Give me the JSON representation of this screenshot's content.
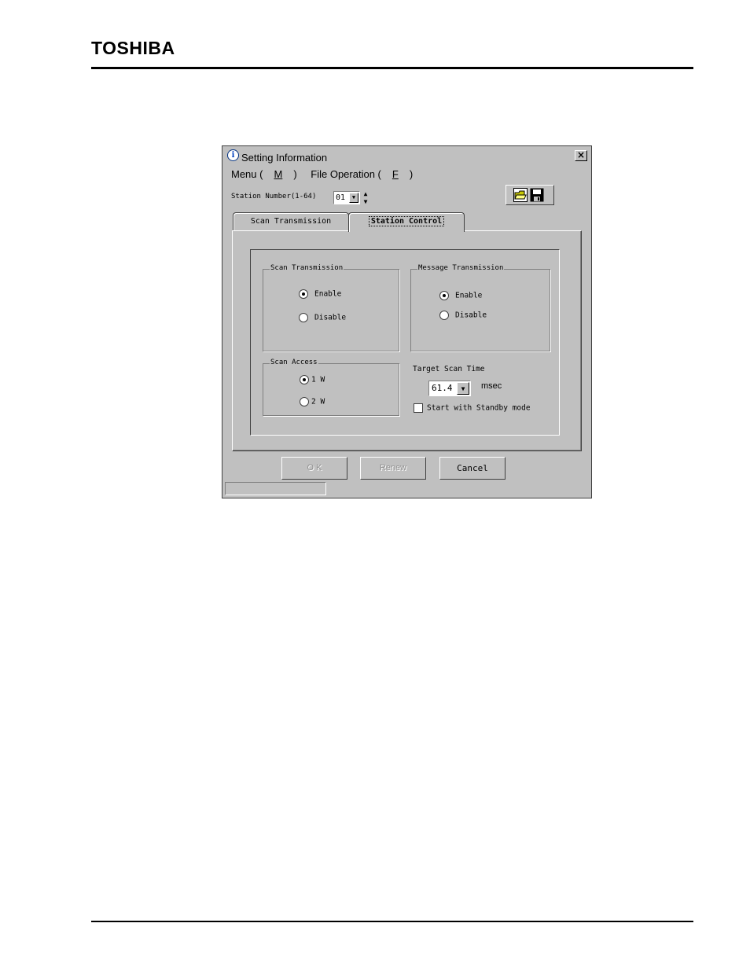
{
  "header": {
    "logo": "TOSHIBA"
  },
  "window": {
    "title": "Setting Information",
    "close_label": "×",
    "menu": {
      "menu_label": "Menu (",
      "menu_key": "M",
      "menu_end": ")",
      "file_label": "File Operation (",
      "file_key": "F",
      "file_end": ")"
    },
    "station": {
      "label": "Station Number(1-64)",
      "value": "01"
    },
    "tabs": [
      {
        "label": "Scan Transmission",
        "active": false
      },
      {
        "label": "Station Control",
        "active": true
      }
    ],
    "scan_transmission": {
      "title": "Scan Transmission",
      "options": [
        {
          "label": "Enable",
          "selected": true
        },
        {
          "label": "Disable",
          "selected": false
        }
      ]
    },
    "message_transmission": {
      "title": "Message Transmission",
      "options": [
        {
          "label": "Enable",
          "selected": true
        },
        {
          "label": "Disable",
          "selected": false
        }
      ]
    },
    "scan_access": {
      "title": "Scan Access",
      "options": [
        {
          "label": "1 W",
          "selected": true
        },
        {
          "label": "2 W",
          "selected": false
        }
      ]
    },
    "target_scan_time": {
      "label": "Target Scan Time",
      "value": "61.4",
      "unit": "msec"
    },
    "standby": {
      "label": "Start with Standby mode",
      "checked": false
    },
    "buttons": {
      "ok": "O K",
      "renew": "Renew",
      "cancel": "Cancel"
    }
  }
}
